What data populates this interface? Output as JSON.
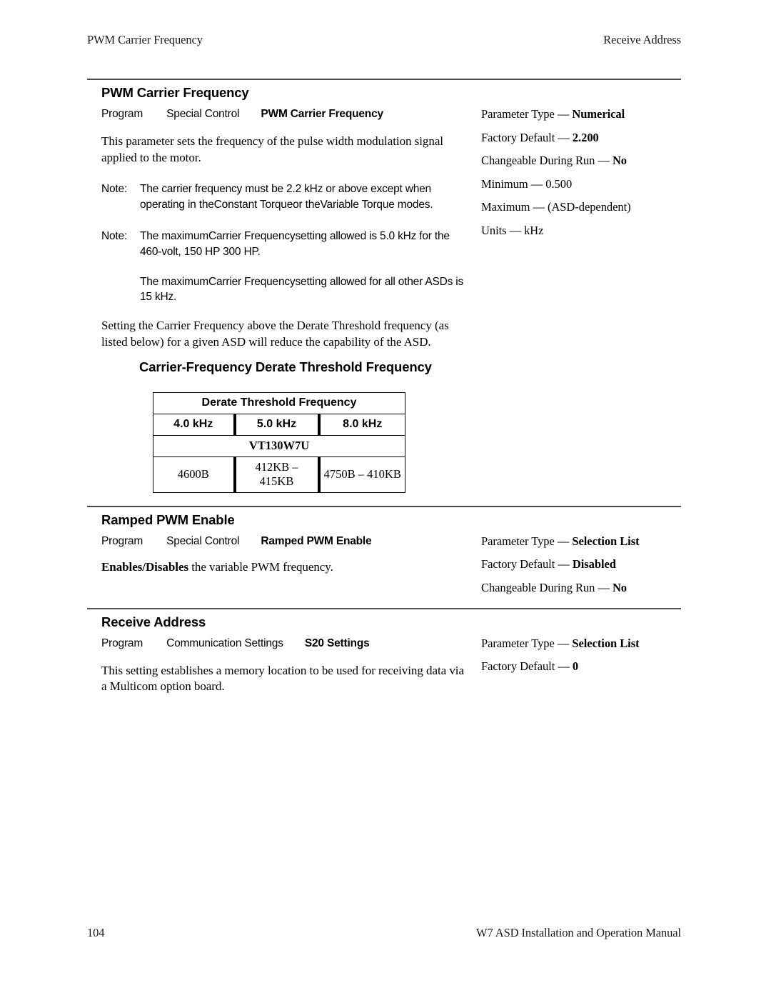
{
  "running_head": {
    "left": "PWM Carrier Frequency",
    "right": "Receive Address"
  },
  "footer": {
    "page_number": "104",
    "manual_title": "W7 ASD Installation and Operation Manual"
  },
  "sections": [
    {
      "title": "PWM Carrier Frequency",
      "breadcrumb": {
        "level1": "Program",
        "level2": "Special Control",
        "level3": "PWM Carrier Frequency"
      },
      "description": "This parameter sets the frequency of the pulse width modulation signal applied to the motor.",
      "notes": [
        {
          "label": "Note:",
          "text": "The carrier frequency must be 2.2 kHz or above except when operating in theConstant Torqueor theVariable Torque modes."
        },
        {
          "label": "Note:",
          "text": "The maximumCarrier Frequencysetting allowed is 5.0 kHz for the 460-volt, 150 HP   300 HP."
        },
        {
          "label": "",
          "text": "The maximumCarrier Frequencysetting allowed for all other ASDs is 15 kHz."
        }
      ],
      "after_notes": "Setting the Carrier Frequency above the Derate Threshold frequency (as listed below) for a given ASD will reduce the capability of the ASD.",
      "subheading": "Carrier-Frequency Derate Threshold Frequency",
      "params": [
        {
          "label": "Parameter Type — ",
          "value": "Numerical",
          "bold": true
        },
        {
          "label": "Factory Default — ",
          "value": "2.200",
          "bold": true
        },
        {
          "label": "Changeable During Run — ",
          "value": "No",
          "bold": true
        },
        {
          "label": "Minimum — ",
          "value": "0.500",
          "bold": false
        },
        {
          "label": "Maximum — ",
          "value": "(ASD-dependent)",
          "bold": false
        },
        {
          "label": "Units — ",
          "value": "kHz",
          "bold": false
        }
      ]
    },
    {
      "title": "Ramped PWM Enable",
      "breadcrumb": {
        "level1": "Program",
        "level2": "Special Control",
        "level3": "Ramped PWM Enable"
      },
      "description_bold": "Enables/Disables",
      "description_rest": " the variable PWM frequency.",
      "params": [
        {
          "label": "Parameter Type — ",
          "value": "Selection List",
          "bold": true
        },
        {
          "label": "Factory Default — ",
          "value": "Disabled",
          "bold": true
        },
        {
          "label": "Changeable During Run — ",
          "value": "No",
          "bold": true
        }
      ]
    },
    {
      "title": "Receive Address",
      "breadcrumb": {
        "level1": "Program",
        "level2": "Communication Settings",
        "level3": "S20 Settings"
      },
      "description": "This setting establishes a memory location to be used for receiving data via a Multicom option board.",
      "params": [
        {
          "label": "Parameter Type — ",
          "value": "Selection List",
          "bold": true
        },
        {
          "label": "Factory Default — ",
          "value": "0",
          "bold": true
        }
      ]
    }
  ],
  "derate_table": {
    "header": "Derate Threshold Frequency",
    "frequency_columns": [
      "4.0 kHz",
      "5.0 kHz",
      "8.0 kHz"
    ],
    "model_row": "VT130W7U",
    "values": [
      "4600B",
      "412KB – 415KB",
      "4750B – 410KB"
    ]
  }
}
